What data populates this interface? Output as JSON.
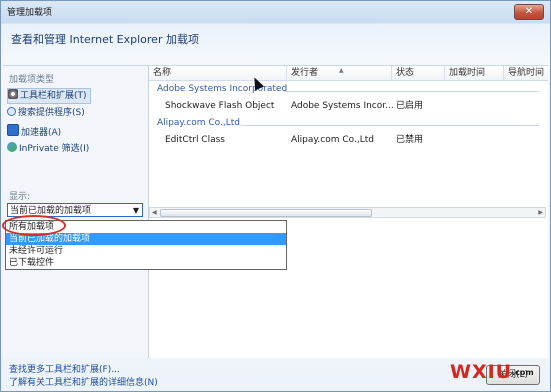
{
  "window": {
    "title": "管理加载项",
    "close_glyph": "✕"
  },
  "header": {
    "subtitle": "查看和管理 Internet Explorer 加载项"
  },
  "left_pane": {
    "heading": "加载项类型",
    "items": [
      {
        "label": "工具栏和扩展(T)",
        "icon": "gear-icon",
        "selected": true
      },
      {
        "label": "搜索提供程序(S)",
        "icon": "search-icon",
        "selected": false
      },
      {
        "label": "加速器(A)",
        "icon": "accelerator-icon",
        "selected": false
      },
      {
        "label": "InPrivate 筛选(I)",
        "icon": "inprivate-icon",
        "selected": false
      }
    ],
    "show_label": "显示:",
    "show_value": "当前已加载的加载项"
  },
  "columns": [
    "名称",
    "发行者",
    "状态",
    "加载时间",
    "导航时间"
  ],
  "groups": [
    {
      "name": "Adobe Systems Incorporated",
      "rows": [
        {
          "name": "Shockwave Flash Object",
          "publisher": "Adobe Systems Incor...",
          "status": "已启用"
        }
      ]
    },
    {
      "name": "Alipay.com Co.,Ltd",
      "rows": [
        {
          "name": "EditCtrl Class",
          "publisher": "Alipay.com Co.,Ltd",
          "status": "已禁用"
        }
      ]
    }
  ],
  "dropdown_options": [
    "所有加载项",
    "当前已加载的加载项",
    "未经许可运行",
    "已下载控件"
  ],
  "dropdown_highlighted": "当前已加载的加载项",
  "footer_links": [
    "查找更多工具栏和扩展(F)...",
    "了解有关工具栏和扩展的详细信息(N)"
  ],
  "close_button": "关闭(L)",
  "watermark": {
    "brand": "WXIU",
    "suffix": ".com"
  },
  "colors": {
    "title_blue": "#1f3e76",
    "link_blue": "#1f4fa8",
    "highlight": "#3399ff",
    "annotation_red": "#d0302c"
  }
}
